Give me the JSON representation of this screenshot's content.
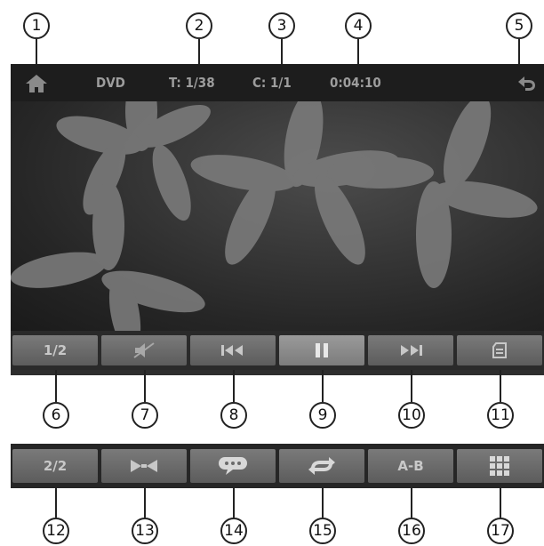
{
  "callouts": [
    "1",
    "2",
    "3",
    "4",
    "5",
    "6",
    "7",
    "8",
    "9",
    "10",
    "11",
    "12",
    "13",
    "14",
    "15",
    "16",
    "17"
  ],
  "status": {
    "source": "DVD",
    "title": "T: 1/38",
    "chapter": "C: 1/1",
    "time": "0:04:10",
    "home_icon": "home-icon",
    "return_icon": "return-icon"
  },
  "toolbar1": {
    "page_label": "1/2",
    "buttons": [
      "page-toggle",
      "mute",
      "previous",
      "pause",
      "next",
      "menu"
    ]
  },
  "toolbar2": {
    "page_label": "2/2",
    "ab_label": "A-B",
    "buttons": [
      "page-toggle",
      "zoom",
      "subtitle",
      "repeat",
      "ab-repeat",
      "keypad"
    ]
  },
  "colors": {
    "bar": "#1d1d1d",
    "button": "#6c6c6c",
    "text": "#9d9d9d"
  }
}
